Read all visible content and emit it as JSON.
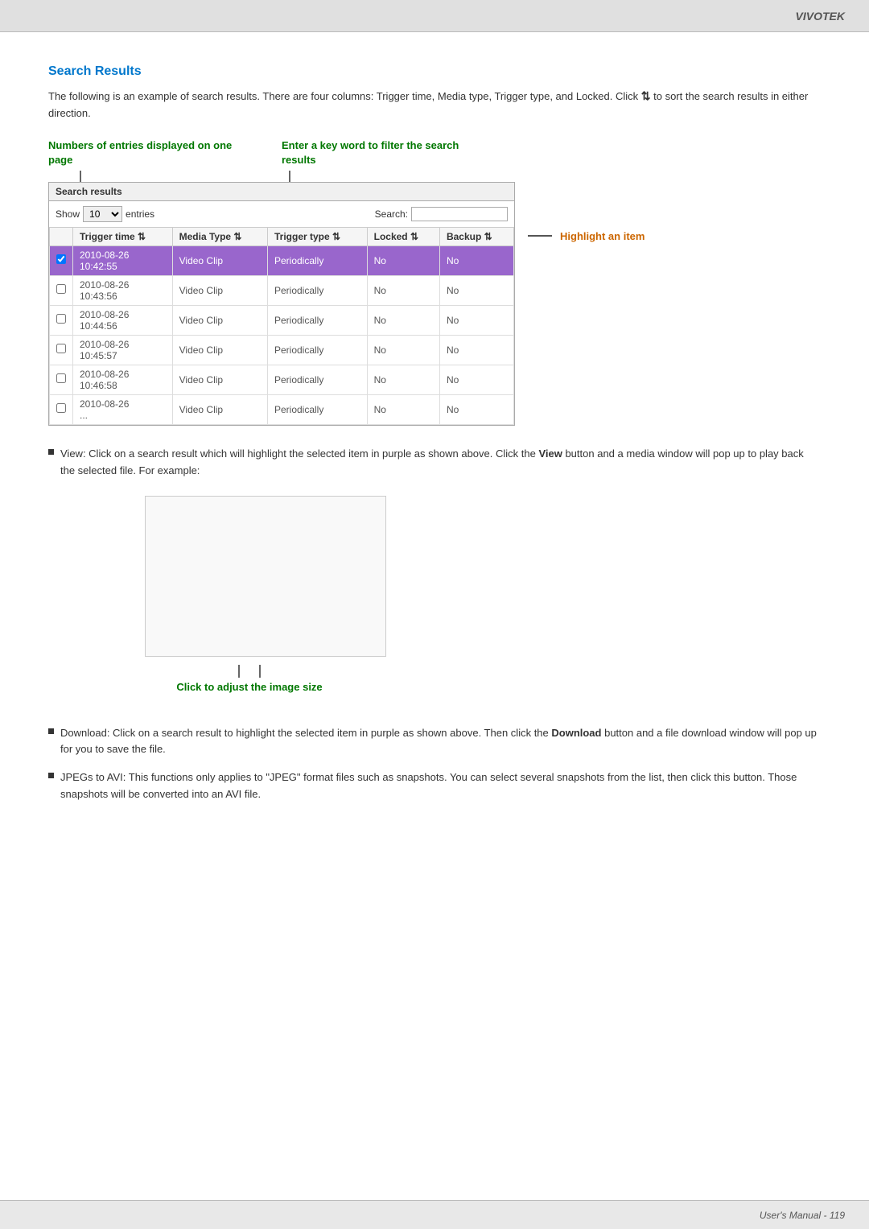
{
  "brand": "VIVOTEK",
  "header": {
    "title": "Search Results",
    "intro": "The following is an example of search results. There are four columns: Trigger time, Media type, Trigger type, and Locked. Click  ⇅  to sort the search results in either direction."
  },
  "annotations": {
    "left_label": "Numbers of entries displayed on one page",
    "right_label": "Enter a key word to filter the search results",
    "highlight_label": "Highlight an item"
  },
  "table": {
    "section_label": "Search results",
    "show_label": "Show",
    "entries_value": "10",
    "entries_label": "entries",
    "search_label": "Search:",
    "search_placeholder": "",
    "columns": [
      "",
      "Trigger time ⇅",
      "Media Type ⇅",
      "Trigger type ⇅",
      "Locked ⇅",
      "Backup ⇅"
    ],
    "rows": [
      {
        "checked": true,
        "highlighted": true,
        "trigger_time": "2010-08-26\n10:42:55",
        "media_type": "Video Clip",
        "trigger_type": "Periodically",
        "locked": "No",
        "backup": "No"
      },
      {
        "checked": false,
        "highlighted": false,
        "trigger_time": "2010-08-26\n10:43:56",
        "media_type": "Video Clip",
        "trigger_type": "Periodically",
        "locked": "No",
        "backup": "No"
      },
      {
        "checked": false,
        "highlighted": false,
        "trigger_time": "2010-08-26\n10:44:56",
        "media_type": "Video Clip",
        "trigger_type": "Periodically",
        "locked": "No",
        "backup": "No"
      },
      {
        "checked": false,
        "highlighted": false,
        "trigger_time": "2010-08-26\n10:45:57",
        "media_type": "Video Clip",
        "trigger_type": "Periodically",
        "locked": "No",
        "backup": "No"
      },
      {
        "checked": false,
        "highlighted": false,
        "trigger_time": "2010-08-26\n10:46:58",
        "media_type": "Video Clip",
        "trigger_type": "Periodically",
        "locked": "No",
        "backup": "No"
      },
      {
        "checked": false,
        "highlighted": false,
        "trigger_time": "2010-08-26\n...",
        "media_type": "Video Clip",
        "trigger_type": "Periodically",
        "locked": "No",
        "backup": "No"
      }
    ]
  },
  "image_adjust_label": "Click to adjust the image size",
  "bullets": [
    {
      "text": "View: Click on a search result which will highlight the selected item in purple as shown above. Click the <b>View</b> button and a media window will pop up to play back the selected file. For example:"
    },
    {
      "text": "Download: Click on a search result to highlight the selected item in purple as shown above. Then click the <b>Download</b> button and a file download window will pop up for you to save the file."
    },
    {
      "text": "JPEGs to AVI: This functions only applies to \"JPEG\" format files such as snapshots. You can select several snapshots from the list, then click this button. Those snapshots will be converted into an AVI file."
    }
  ],
  "footer": {
    "text": "User's Manual - 119"
  }
}
